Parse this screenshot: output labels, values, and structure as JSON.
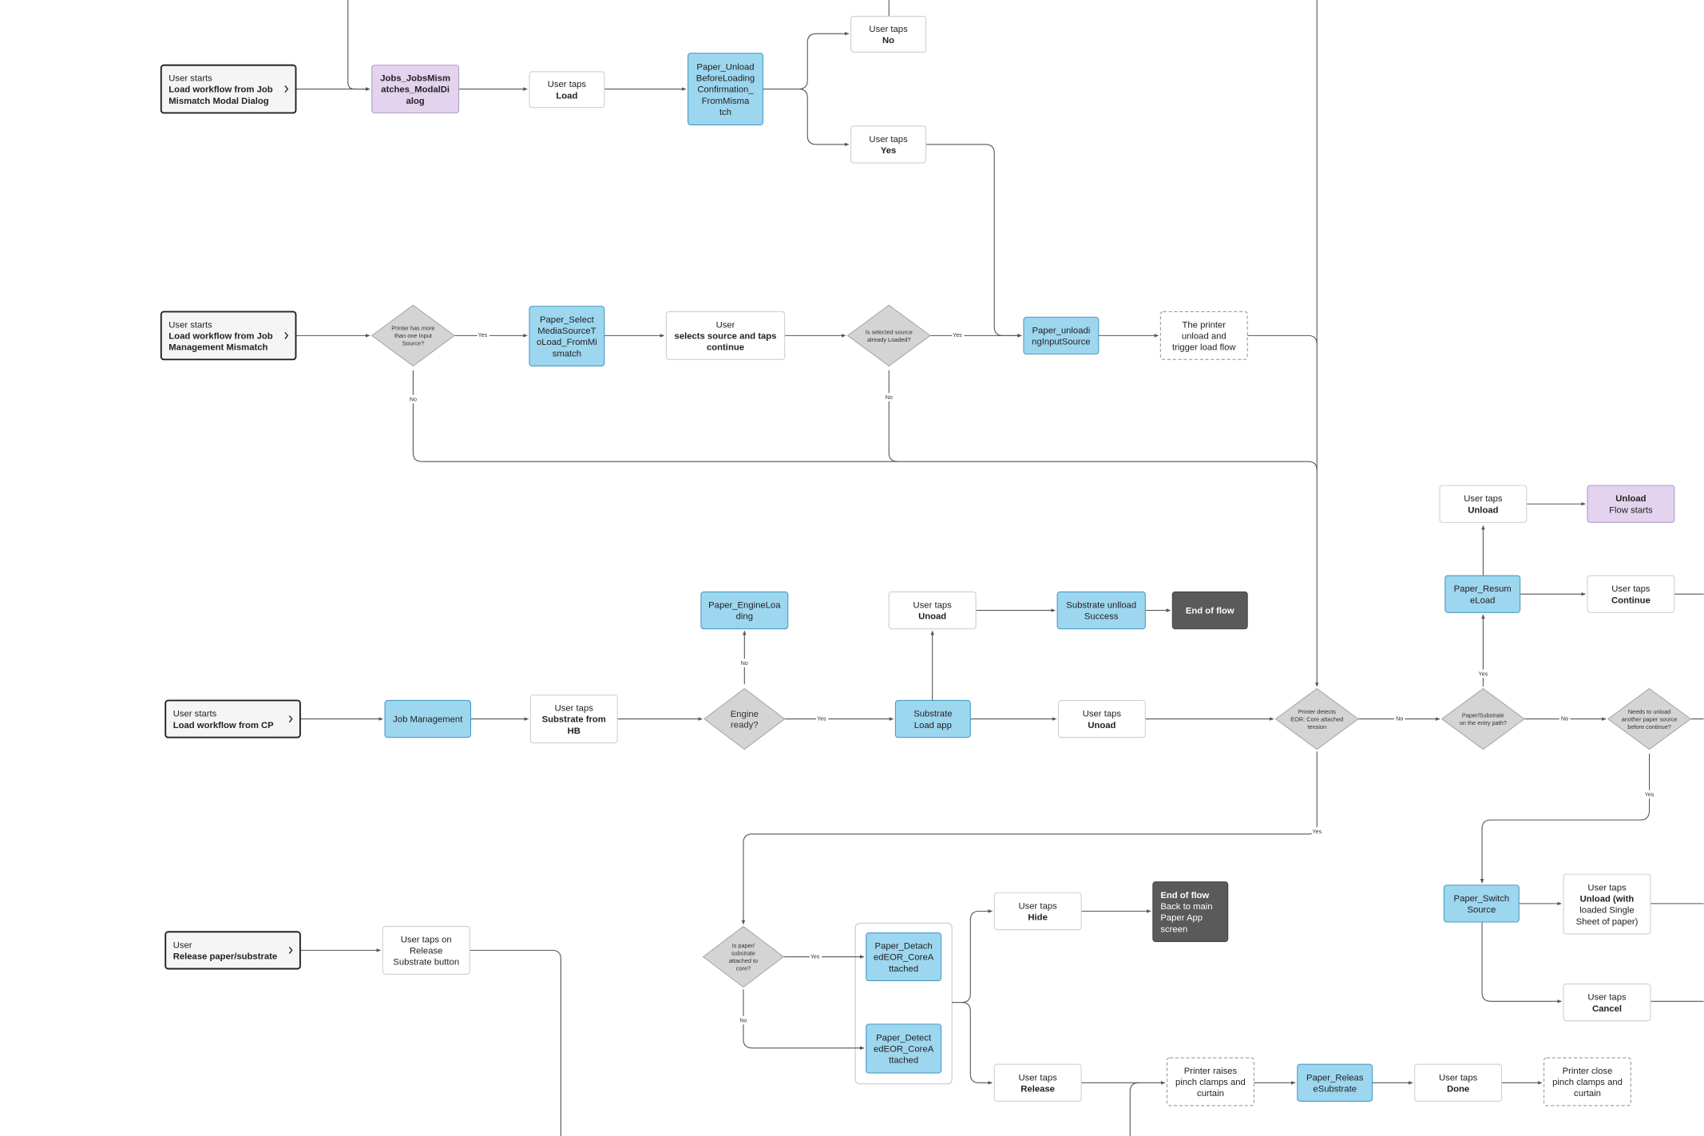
{
  "colors": {
    "screen_fill": "#9dd6ef",
    "screen_stroke": "#4a9cc4",
    "flow_fill": "#e3d3ee",
    "flow_stroke": "#b39bc8",
    "action_fill": "#ffffff",
    "action_stroke": "#cfcfcf",
    "decision_fill": "#d4d4d4",
    "decision_stroke": "#a8a8a8",
    "end_fill": "#5a5a5a",
    "start_fill": "#f5f5f5",
    "start_stroke": "#222222",
    "connector": "#555555"
  },
  "nodes": [
    {
      "id": "start1",
      "kind": "start",
      "lines": [
        {
          "t": "User starts"
        },
        {
          "t": "Load workflow from Job",
          "b": true
        },
        {
          "t": "Mismatch Modal Dialog",
          "b": true
        }
      ],
      "icon": "chevron-right-icon"
    },
    {
      "id": "jobsModal",
      "kind": "flow",
      "lines": [
        {
          "t": "Jobs_JobsMism",
          "b": true
        },
        {
          "t": "atches_ModalDi",
          "b": true
        },
        {
          "t": "alog",
          "b": true
        }
      ]
    },
    {
      "id": "tapsLoad",
      "kind": "action",
      "lines": [
        {
          "t": "User taps"
        },
        {
          "t": "Load",
          "b": true
        }
      ]
    },
    {
      "id": "unloadConf",
      "kind": "screen",
      "lines": [
        {
          "t": "Paper_Unload"
        },
        {
          "t": "BeforeLoading"
        },
        {
          "t": "Confirmation_"
        },
        {
          "t": "FromMisma"
        },
        {
          "t": "tch"
        }
      ]
    },
    {
      "id": "tapsNo",
      "kind": "action",
      "lines": [
        {
          "t": "User taps"
        },
        {
          "t": "No",
          "b": true
        }
      ]
    },
    {
      "id": "tapsYes",
      "kind": "action",
      "lines": [
        {
          "t": "User taps"
        },
        {
          "t": "Yes",
          "b": true
        }
      ]
    },
    {
      "id": "start2",
      "kind": "start",
      "lines": [
        {
          "t": "User starts"
        },
        {
          "t": "Load workflow from Job",
          "b": true
        },
        {
          "t": "Management Mismatch",
          "b": true
        }
      ],
      "icon": "chevron-right-icon"
    },
    {
      "id": "d1",
      "kind": "decision",
      "lines": [
        {
          "t": "Printer has more"
        },
        {
          "t": "than one Input"
        },
        {
          "t": "Source?"
        }
      ]
    },
    {
      "id": "selectMedia",
      "kind": "screen",
      "lines": [
        {
          "t": "Paper_Select"
        },
        {
          "t": "MediaSourceT"
        },
        {
          "t": "oLoad_FromMi"
        },
        {
          "t": "smatch"
        }
      ]
    },
    {
      "id": "selectsSource",
      "kind": "action",
      "lines": [
        {
          "t": "User"
        },
        {
          "t": "selects source and taps",
          "b": true
        },
        {
          "t": "continue",
          "b": true
        }
      ]
    },
    {
      "id": "d2",
      "kind": "decision",
      "lines": [
        {
          "t": "Is selected source"
        },
        {
          "t": "already Loaded?"
        }
      ]
    },
    {
      "id": "unloadingInput",
      "kind": "screen",
      "lines": [
        {
          "t": "Paper_unloadi"
        },
        {
          "t": "ngInputSource"
        }
      ]
    },
    {
      "id": "printerUnload",
      "kind": "system",
      "lines": [
        {
          "t": "The printer"
        },
        {
          "t": "unload and"
        },
        {
          "t": "trigger load flow"
        }
      ]
    },
    {
      "id": "start3",
      "kind": "start",
      "lines": [
        {
          "t": "User starts"
        },
        {
          "t": "Load workflow from CP",
          "b": true
        }
      ],
      "icon": "chevron-right-icon"
    },
    {
      "id": "jobMgmt",
      "kind": "screen",
      "lines": [
        {
          "t": "Job Management"
        }
      ]
    },
    {
      "id": "tapsSubstrate",
      "kind": "action",
      "lines": [
        {
          "t": "User taps"
        },
        {
          "t": "Substrate from",
          "b": true
        },
        {
          "t": "HB",
          "b": true
        }
      ]
    },
    {
      "id": "d3",
      "kind": "decision",
      "big": true,
      "lines": [
        {
          "t": "Engine"
        },
        {
          "t": "ready?"
        }
      ]
    },
    {
      "id": "engineLoading",
      "kind": "screen",
      "lines": [
        {
          "t": "Paper_EngineLoa"
        },
        {
          "t": "ding"
        }
      ]
    },
    {
      "id": "substrateLoad",
      "kind": "screen",
      "lines": [
        {
          "t": "Substrate"
        },
        {
          "t": "Load app"
        }
      ]
    },
    {
      "id": "tapsUnoad1",
      "kind": "action",
      "lines": [
        {
          "t": "User taps"
        },
        {
          "t": "Unoad",
          "b": true
        }
      ]
    },
    {
      "id": "unloadSuccess",
      "kind": "screen",
      "lines": [
        {
          "t": "Substrate unlload"
        },
        {
          "t": "Success"
        }
      ]
    },
    {
      "id": "endFlow1",
      "kind": "end",
      "lines": [
        {
          "t": "End of flow",
          "b": true
        }
      ]
    },
    {
      "id": "tapsUnoad2",
      "kind": "action",
      "lines": [
        {
          "t": "User taps"
        },
        {
          "t": "Unoad",
          "b": true
        }
      ]
    },
    {
      "id": "d4",
      "kind": "decision",
      "lines": [
        {
          "t": "Printer detects"
        },
        {
          "t": "EOR: Core attached"
        },
        {
          "t": "tension"
        }
      ]
    },
    {
      "id": "d5",
      "kind": "decision",
      "lines": [
        {
          "t": "Paper/Substrate"
        },
        {
          "t": "on the entry path?"
        }
      ]
    },
    {
      "id": "d6",
      "kind": "decision",
      "lines": [
        {
          "t": "Needs to unload"
        },
        {
          "t": "another paper source"
        },
        {
          "t": "before continue?"
        }
      ]
    },
    {
      "id": "resumeLoad",
      "kind": "screen",
      "lines": [
        {
          "t": "Paper_Resum"
        },
        {
          "t": "eLoad"
        }
      ]
    },
    {
      "id": "tapsUnload",
      "kind": "action",
      "lines": [
        {
          "t": "User taps"
        },
        {
          "t": "Unload",
          "b": true
        }
      ]
    },
    {
      "id": "unloadFlow",
      "kind": "flow",
      "lines": [
        {
          "t": "Unload",
          "b": true
        },
        {
          "t": "Flow starts"
        }
      ]
    },
    {
      "id": "tapsContinue",
      "kind": "action",
      "lines": [
        {
          "t": "User taps"
        },
        {
          "t": "Continue",
          "b": true
        }
      ]
    },
    {
      "id": "switchSource",
      "kind": "screen",
      "lines": [
        {
          "t": "Paper_Switch"
        },
        {
          "t": "Source"
        }
      ]
    },
    {
      "id": "tapsUnloadSingle",
      "kind": "action",
      "lines": [
        {
          "t": "User taps"
        },
        {
          "t": "Unload (with",
          "b": true
        },
        {
          "t": "loaded Single"
        },
        {
          "t": "Sheet of paper)"
        }
      ]
    },
    {
      "id": "tapsCancel",
      "kind": "action",
      "lines": [
        {
          "t": "User taps"
        },
        {
          "t": "Cancel",
          "b": true
        }
      ]
    },
    {
      "id": "start4",
      "kind": "start",
      "lines": [
        {
          "t": "User"
        },
        {
          "t": "Release paper/substrate",
          "b": true
        }
      ],
      "icon": "chevron-right-icon"
    },
    {
      "id": "releaseBtn",
      "kind": "action",
      "lines": [
        {
          "t": "User taps on"
        },
        {
          "t": "Release"
        },
        {
          "t": "Substrate button"
        }
      ]
    },
    {
      "id": "d7",
      "kind": "decision",
      "lines": [
        {
          "t": "Is paper/"
        },
        {
          "t": "substrate"
        },
        {
          "t": "attached to"
        },
        {
          "t": "core?"
        }
      ]
    },
    {
      "id": "detached",
      "kind": "screen",
      "lines": [
        {
          "t": "Paper_Detach"
        },
        {
          "t": "edEOR_CoreA"
        },
        {
          "t": "ttached"
        }
      ]
    },
    {
      "id": "detected",
      "kind": "screen",
      "lines": [
        {
          "t": "Paper_Detect"
        },
        {
          "t": "edEOR_CoreA"
        },
        {
          "t": "ttached"
        }
      ]
    },
    {
      "id": "tapsHide",
      "kind": "action",
      "lines": [
        {
          "t": "User taps"
        },
        {
          "t": "Hide",
          "b": true
        }
      ]
    },
    {
      "id": "endFlow2",
      "kind": "end",
      "lines": [
        {
          "t": "End of flow",
          "b": true
        },
        {
          "t": "Back to main"
        },
        {
          "t": "Paper App"
        },
        {
          "t": "screen"
        }
      ]
    },
    {
      "id": "tapsRelease",
      "kind": "action",
      "lines": [
        {
          "t": "User taps"
        },
        {
          "t": "Release",
          "b": true
        }
      ]
    },
    {
      "id": "pinchRaise",
      "kind": "system",
      "lines": [
        {
          "t": "Printer raises"
        },
        {
          "t": "pinch clamps and"
        },
        {
          "t": "curtain"
        }
      ]
    },
    {
      "id": "releaseSubstrate",
      "kind": "screen",
      "lines": [
        {
          "t": "Paper_Releas"
        },
        {
          "t": "eSubstrate"
        }
      ]
    },
    {
      "id": "tapsDone",
      "kind": "action",
      "lines": [
        {
          "t": "User taps"
        },
        {
          "t": "Done",
          "b": true
        }
      ]
    },
    {
      "id": "pinchClose",
      "kind": "system",
      "lines": [
        {
          "t": "Printer close"
        },
        {
          "t": "pinch clamps and"
        },
        {
          "t": "curtain"
        }
      ]
    }
  ],
  "edge_labels": [
    "Yes",
    "No",
    "Yes",
    "No",
    "Yes",
    "No",
    "No",
    "No",
    "Yes",
    "Yes",
    "Yes",
    "Yes",
    "No"
  ]
}
